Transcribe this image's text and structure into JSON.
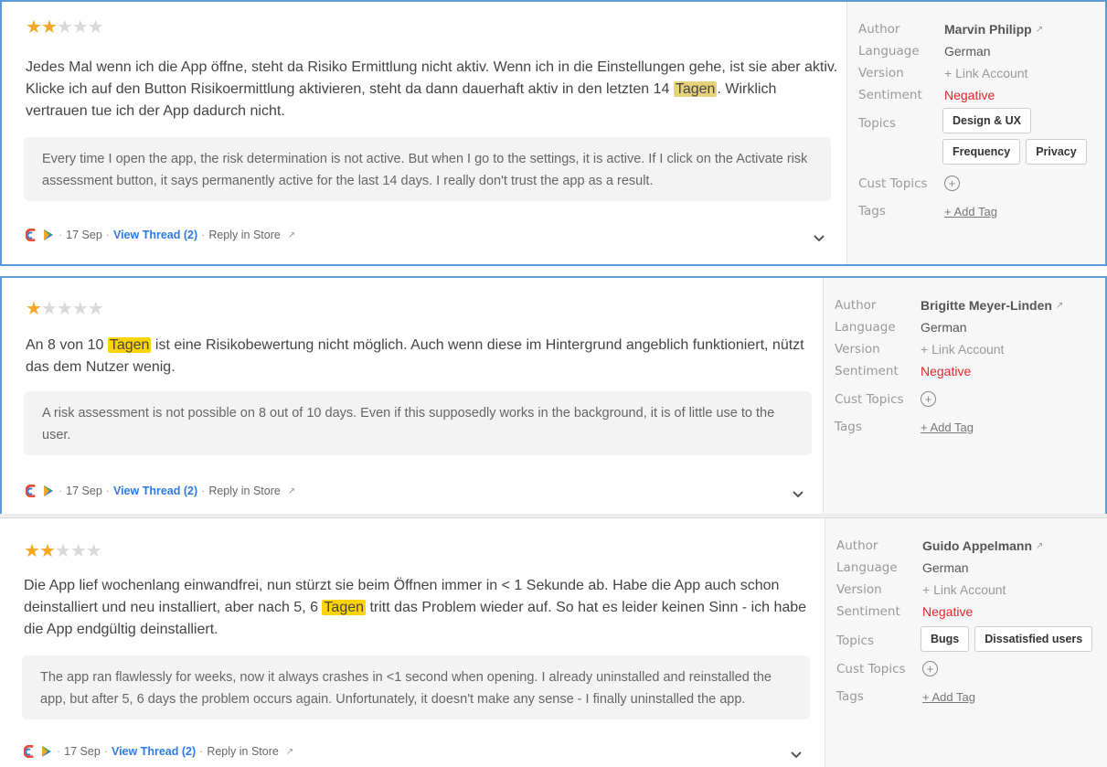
{
  "labels": {
    "author": "Author",
    "language": "Language",
    "version": "Version",
    "sentiment": "Sentiment",
    "topics": "Topics",
    "cust_topics": "Cust Topics",
    "tags": "Tags"
  },
  "ui": {
    "view_thread": "View Thread (2)",
    "reply_store": "Reply in Store",
    "add_tag": "+ Add Tag",
    "link_account": "+ Link Account",
    "sep": "·",
    "plus": "+",
    "ext_glyph": "↗"
  },
  "reviews": [
    {
      "stars": 2,
      "text_before": "Jedes Mal wenn ich die App öffne, steht da Risiko Ermittlung nicht aktiv. Wenn ich in die Einstellungen gehe, ist sie aber aktiv. Klicke ich auf den Button Risikoermittlung aktivieren, steht da dann dauerhaft aktiv in den letzten 14 ",
      "highlight": "Tagen",
      "text_after": ". Wirklich vertrauen tue ich der App dadurch nicht.",
      "translation": "Every time I open the app, the risk determination is not active. But when I go to the settings, it is active. If I click on the Activate risk assessment button, it says permanently active for the last 14 days. I really don't trust the app as a result.",
      "date": "17 Sep",
      "author": "Marvin Philipp",
      "language": "German",
      "sentiment": "Negative",
      "topics": [
        "Design & UX",
        "Frequency",
        "Privacy"
      ]
    },
    {
      "stars": 1,
      "text_before": "An 8 von 10 ",
      "highlight": "Tagen",
      "text_after": " ist eine Risikobewertung nicht möglich. Auch wenn diese im Hintergrund angeblich funktioniert, nützt das dem Nutzer wenig.",
      "translation": "A risk assessment is not possible on 8 out of 10 days. Even if this supposedly works in the background, it is of little use to the user.",
      "date": "17 Sep",
      "author": "Brigitte Meyer-Linden",
      "language": "German",
      "sentiment": "Negative",
      "topics": []
    },
    {
      "stars": 2,
      "text_before": "Die App lief wochenlang einwandfrei, nun stürzt sie beim Öffnen immer in < 1 Sekunde ab. Habe die App auch schon deinstalliert und neu installiert, aber nach 5, 6 ",
      "highlight": "Tagen",
      "text_after": " tritt das Problem wieder auf. So hat es leider keinen Sinn - ich habe die App endgültig deinstalliert.",
      "translation": "The app ran flawlessly for weeks, now it always crashes in <1 second when opening. I already uninstalled and reinstalled the app, but after 5, 6 days the problem occurs again. Unfortunately, it doesn't make any sense - I finally uninstalled the app.",
      "date": "17 Sep",
      "author": "Guido Appelmann",
      "language": "German",
      "sentiment": "Negative",
      "topics": [
        "Bugs",
        "Dissatisfied users"
      ]
    }
  ],
  "colors": {
    "star": "#f5a623",
    "star_off": "#d9d9d9",
    "negative": "#e0262c",
    "link": "#2e7be6",
    "selected_border": "#5b9bd5",
    "highlight_muted": "#e6d27a",
    "highlight_bright": "#ffd400"
  },
  "icons": {
    "app_icon": "app-logo-icon",
    "store_icon": "google-play-icon",
    "external": "external-link-icon",
    "expand": "chevron-down-icon",
    "add_topic": "plus-circle-icon"
  }
}
